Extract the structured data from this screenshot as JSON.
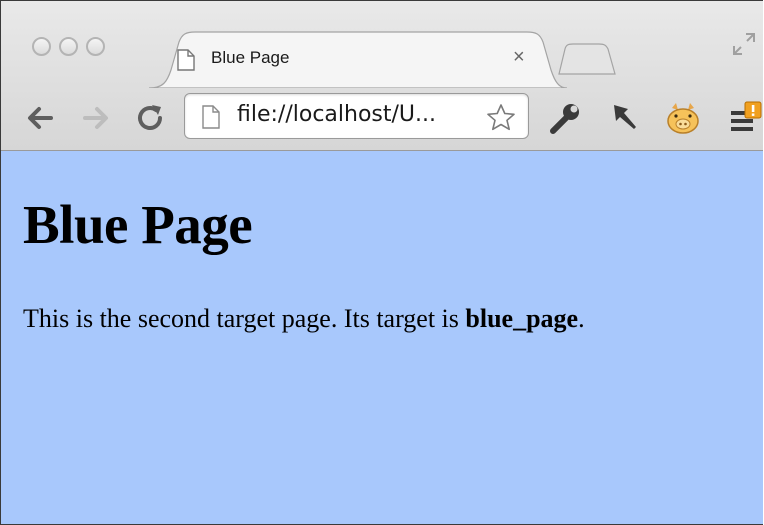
{
  "browser": {
    "tab": {
      "title": "Blue Page",
      "close_glyph": "×"
    },
    "address_bar": {
      "url": "file://localhost/U..."
    },
    "icons": {
      "traffic_lights": [
        "close-dot",
        "minimize-dot",
        "zoom-dot"
      ],
      "tab_favicon": "page-icon",
      "new_tab": "new-tab-icon",
      "fullscreen": "fullscreen-icon",
      "back": "back-arrow-icon",
      "forward": "forward-arrow-icon",
      "reload": "reload-icon",
      "bookmark": "star-icon",
      "extensions": [
        "wrench-icon",
        "pin-icon",
        "piggy-bank-icon",
        "menu-notification-icon"
      ]
    }
  },
  "page": {
    "background_color": "#a8c8fc",
    "heading": "Blue Page",
    "paragraph": {
      "prefix": "This is the second target page. Its target is ",
      "bold": "blue_page",
      "suffix": "."
    }
  }
}
